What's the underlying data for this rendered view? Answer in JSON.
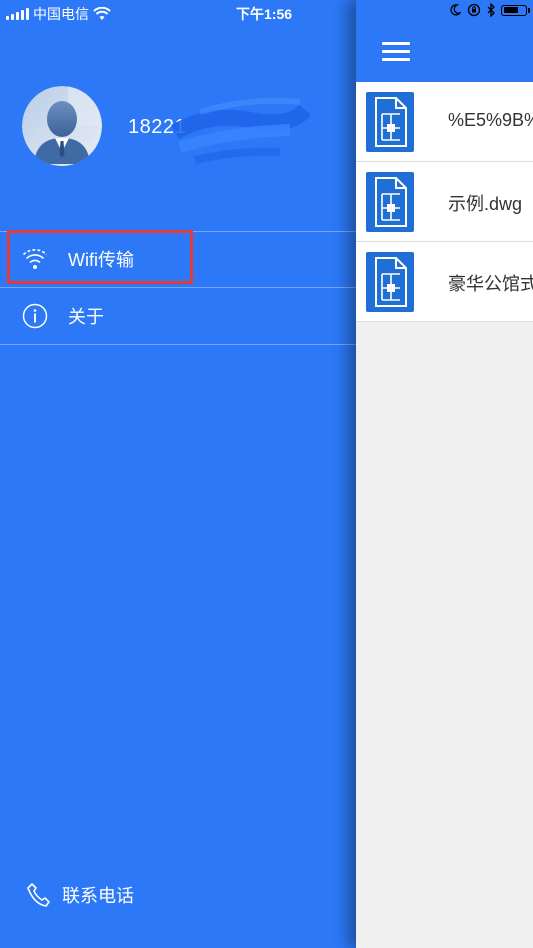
{
  "status_bar": {
    "carrier": "中国电信",
    "time": "下午1:56"
  },
  "profile": {
    "username": "18221"
  },
  "menu": {
    "items": [
      {
        "label": "Wifi传输",
        "icon": "wifi-icon"
      },
      {
        "label": "关于",
        "icon": "info-icon"
      }
    ]
  },
  "footer": {
    "contact_label": "联系电话",
    "icon": "phone-icon"
  },
  "files": [
    {
      "name": "%E5%9B%",
      "icon": "cad-file-icon"
    },
    {
      "name": "示例.dwg",
      "icon": "cad-file-icon"
    },
    {
      "name": "豪华公馆式",
      "icon": "cad-file-icon"
    }
  ],
  "colors": {
    "primary": "#2c78f6",
    "highlight": "#e23b3b",
    "file_icon": "#1f6fd6",
    "list_bg": "#f0f0f0"
  }
}
